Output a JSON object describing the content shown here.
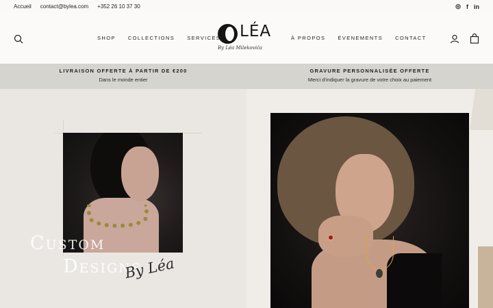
{
  "topbar": {
    "links": [
      "Accueil",
      "contact@bylea.com",
      "+352 26 10 37 30"
    ],
    "social": [
      {
        "icon": "instagram-icon",
        "glyph": "◎"
      },
      {
        "icon": "facebook-icon",
        "glyph": "f"
      },
      {
        "icon": "linkedin-icon",
        "glyph": "in"
      }
    ]
  },
  "header": {
    "logo_text": "LÉA",
    "logo_sub": "By Léa Milekovića",
    "nav_left": [
      "SHOP",
      "COLLECTIONS",
      "SERVICES"
    ],
    "nav_right": [
      "À PROPOS",
      "ÉVENEMENTS",
      "CONTACT"
    ]
  },
  "promo": [
    {
      "title": "LIVRAISON OFFERTE À PARTIR DE €200",
      "subtitle": "Dans le monde entier"
    },
    {
      "title": "GRAVURE PERSONNALISÉE OFFERTE",
      "subtitle": "Merci d'indiquer la gravure de votre choix au paiement"
    }
  ],
  "hero": {
    "line1": "Custom",
    "line2": "Designs",
    "signature": "By Léa"
  },
  "colors": {
    "promo_bg": "#d6d4cf",
    "hero_bg": "#eae7e2",
    "text": "#1a1a1a"
  }
}
